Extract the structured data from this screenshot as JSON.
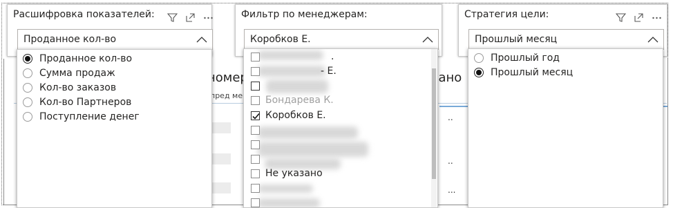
{
  "background": {
    "header_fragment_left": "номер",
    "header_fragment_right": "дано",
    "subheader_fragment": "пред  ме",
    "cell_dots": [
      "..",
      "..",
      "..."
    ],
    "accent_color": "#78a9d8"
  },
  "slicer_metrics": {
    "title": "Расшифровка показателей:",
    "selected": "Проданное кол-во",
    "options": [
      {
        "label": "Проданное кол-во",
        "checked": true
      },
      {
        "label": "Сумма продаж",
        "checked": false
      },
      {
        "label": "Кол-во заказов",
        "checked": false
      },
      {
        "label": "Кол-во Партнеров",
        "checked": false
      },
      {
        "label": "Поступление денег",
        "checked": false
      }
    ],
    "icons": [
      "filter-icon",
      "focus-mode-icon",
      "more-options-icon"
    ]
  },
  "slicer_managers": {
    "title": "Фильтр по менеджерам:",
    "selected": "Коробков Е.",
    "options": [
      {
        "label": "",
        "checked": false,
        "redacted": true
      },
      {
        "label": "",
        "checked": false,
        "redacted": true
      },
      {
        "label": "",
        "checked": false,
        "redacted": true
      },
      {
        "label": "",
        "checked": false,
        "redacted": true
      },
      {
        "label": "Коробков Е.",
        "checked": true,
        "redacted": false
      },
      {
        "label": "",
        "checked": false,
        "redacted": true
      },
      {
        "label": "",
        "checked": false,
        "redacted": true
      },
      {
        "label": "",
        "checked": false,
        "redacted": true
      },
      {
        "label": "Не указано",
        "checked": false,
        "redacted": false
      },
      {
        "label": "",
        "checked": false,
        "redacted": true
      },
      {
        "label": "",
        "checked": false,
        "redacted": true
      }
    ],
    "partial_labels": {
      "row1_suffix": ".",
      "row2_suffix": "- Е.",
      "row4_text": "Бондарева К."
    }
  },
  "slicer_strategy": {
    "title": "Стратегия цели:",
    "selected": "Прошлый месяц",
    "options": [
      {
        "label": "Прошлый год",
        "checked": false
      },
      {
        "label": "Прошлый месяц",
        "checked": true
      }
    ],
    "icons": [
      "filter-icon",
      "focus-mode-icon",
      "more-options-icon"
    ]
  }
}
